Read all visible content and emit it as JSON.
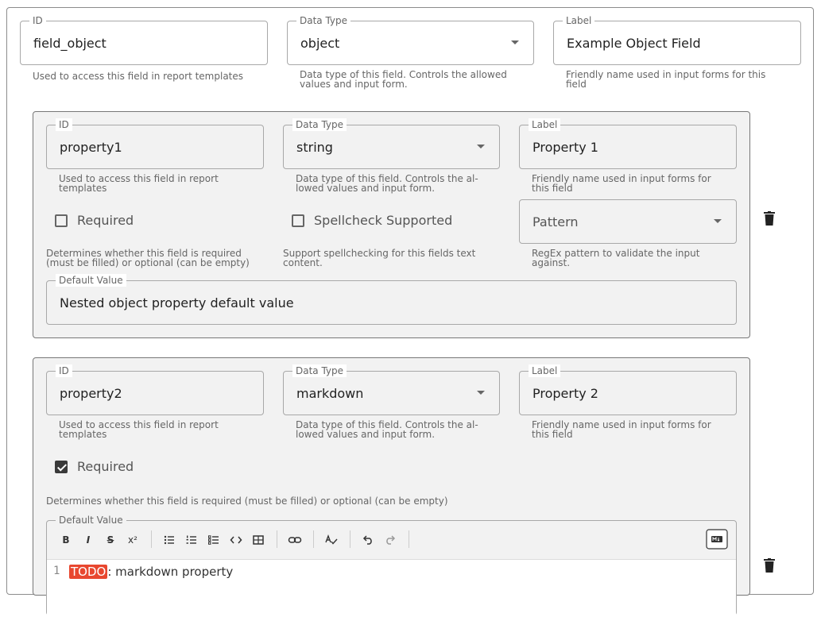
{
  "top": {
    "id": {
      "label": "ID",
      "value": "field_object",
      "hint": "Used to access this field in report templates"
    },
    "type": {
      "label": "Data Type",
      "value": "object",
      "hint1": "Data type of this field. Controls the allowed",
      "hint2": "values and input form."
    },
    "label": {
      "label": "Label",
      "value": "Example Object Field",
      "hint1": "Friendly name used in input forms for this",
      "hint2": "field"
    }
  },
  "prop1": {
    "id": {
      "label": "ID",
      "value": "property1",
      "hint1": "Used to access this field in report",
      "hint2": "templates"
    },
    "type": {
      "label": "Data Type",
      "value": "string",
      "hint1": "Data type of this field. Controls the al-",
      "hint2": "lowed values and input form."
    },
    "label": {
      "label": "Label",
      "value": "Property 1",
      "hint1": "Friendly name used in input forms for",
      "hint2": "this field"
    },
    "required": {
      "label": "Required",
      "checked": false,
      "hint1": "Determines whether this field is required",
      "hint2": "(must be filled) or optional (can be empty)"
    },
    "spellcheck": {
      "label": "Spellcheck Supported",
      "checked": false,
      "hint1": "Support spellchecking for this fields text",
      "hint2": "content."
    },
    "pattern": {
      "placeholder": "Pattern",
      "hint1": "RegEx pattern to validate the input",
      "hint2": "against."
    },
    "default": {
      "label": "Default Value",
      "value": "Nested object property default value"
    }
  },
  "prop2": {
    "id": {
      "label": "ID",
      "value": "property2",
      "hint1": "Used to access this field in report",
      "hint2": "templates"
    },
    "type": {
      "label": "Data Type",
      "value": "markdown",
      "hint1": "Data type of this field. Controls the al-",
      "hint2": "lowed values and input form."
    },
    "label": {
      "label": "Label",
      "value": "Property 2",
      "hint1": "Friendly name used in input forms for",
      "hint2": "this field"
    },
    "required": {
      "label": "Required",
      "checked": true,
      "hint": "Determines whether this field is required (must be filled) or optional (can be empty)"
    },
    "default": {
      "label": "Default Value",
      "toolbar": {
        "bold": "B",
        "italic": "I",
        "strike": "S",
        "superscript": "x²"
      },
      "line_number": "1",
      "todo": "TODO",
      "text": ": markdown property"
    }
  },
  "icons": [
    "chevron-down-icon",
    "trash-icon",
    "bold-icon",
    "italic-icon",
    "strikethrough-icon",
    "superscript-icon",
    "bullet-list-icon",
    "numbered-list-icon",
    "checklist-icon",
    "code-icon",
    "table-icon",
    "link-icon",
    "spellcheck-icon",
    "undo-icon",
    "redo-icon",
    "markdown-toggle-icon"
  ],
  "colors": {
    "todo": "#e8472f",
    "card_bg": "#f2f2f2"
  }
}
